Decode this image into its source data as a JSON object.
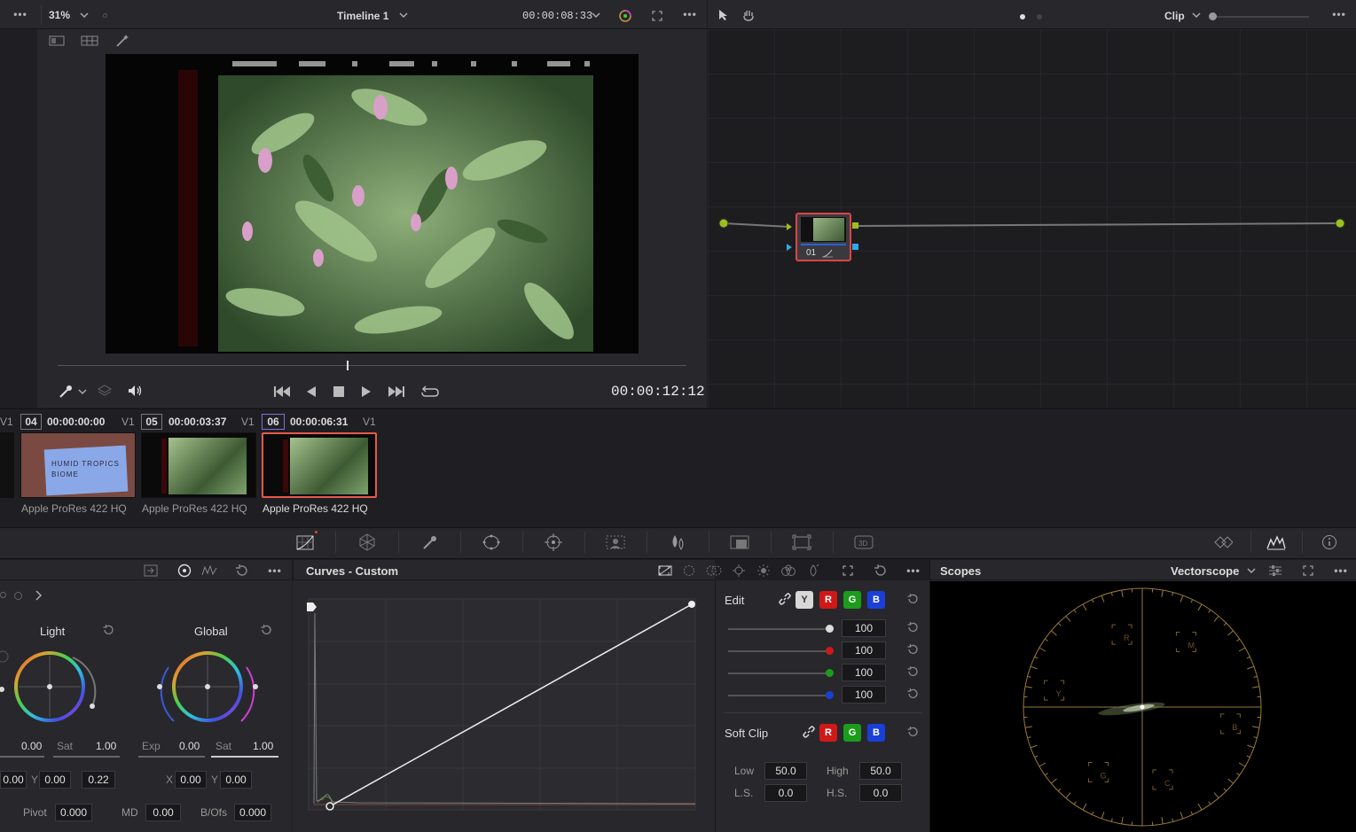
{
  "viewer": {
    "zoom": "31%",
    "timeline_name": "Timeline 1",
    "timecode_top": "00:00:08:33",
    "timecode_main": "00:00:12:12",
    "scrub_position": 0.46
  },
  "node_editor": {
    "mode": "Clip",
    "node_label": "01"
  },
  "clips": [
    {
      "num": "04",
      "timecode": "00:00:00:00",
      "track": "V1",
      "codec": "Apple ProRes 422 HQ",
      "thumb_text_1": "HUMID TROPICS",
      "thumb_text_2": "BIOME",
      "selected": false
    },
    {
      "num": "05",
      "timecode": "00:00:03:37",
      "track": "V1",
      "codec": "Apple ProRes 422 HQ",
      "selected": false
    },
    {
      "num": "06",
      "timecode": "00:00:06:31",
      "track": "V1",
      "codec": "Apple ProRes 422 HQ",
      "selected": true
    }
  ],
  "left_track_label": "V1",
  "wheels": {
    "light_title": "Light",
    "global_title": "Global",
    "light_left_val": "0.00",
    "light_sat_label": "Sat",
    "light_sat_val": "1.00",
    "exp_label": "Exp",
    "exp_val": "0.00",
    "global_sat_label": "Sat",
    "global_sat_val": "1.00",
    "light_x_val": "0.00",
    "light_y_label": "Y",
    "light_y_val": "0.00",
    "light_l_val": "0.22",
    "global_x_label": "X",
    "global_x_val": "0.00",
    "global_y_label": "Y",
    "global_y_val": "0.00",
    "pivot_label": "Pivot",
    "pivot_val": "0.000",
    "md_label": "MD",
    "md_val": "0.00",
    "bofs_label": "B/Ofs",
    "bofs_val": "0.000"
  },
  "curves": {
    "title": "Curves - Custom"
  },
  "edit": {
    "label": "Edit",
    "channels": [
      "Y",
      "R",
      "G",
      "B"
    ],
    "values": [
      "100",
      "100",
      "100",
      "100"
    ],
    "soft_clip_label": "Soft Clip",
    "soft_channels": [
      "R",
      "G",
      "B"
    ],
    "low_label": "Low",
    "low_val": "50.0",
    "high_label": "High",
    "high_val": "50.0",
    "ls_label": "L.S.",
    "ls_val": "0.0",
    "hs_label": "H.S.",
    "hs_val": "0.0"
  },
  "scopes": {
    "title": "Scopes",
    "type": "Vectorscope",
    "targets": [
      "R",
      "M",
      "Y",
      "B",
      "G",
      "C"
    ]
  },
  "colors": {
    "accent_red": "#e0453a",
    "selected_border": "#e8584a",
    "chan_y": "#d8d8d8",
    "chan_r": "#d01818",
    "chan_g": "#1b9c1b",
    "chan_b": "#1a3fd8",
    "scope_gold": "#9a7a3a"
  }
}
